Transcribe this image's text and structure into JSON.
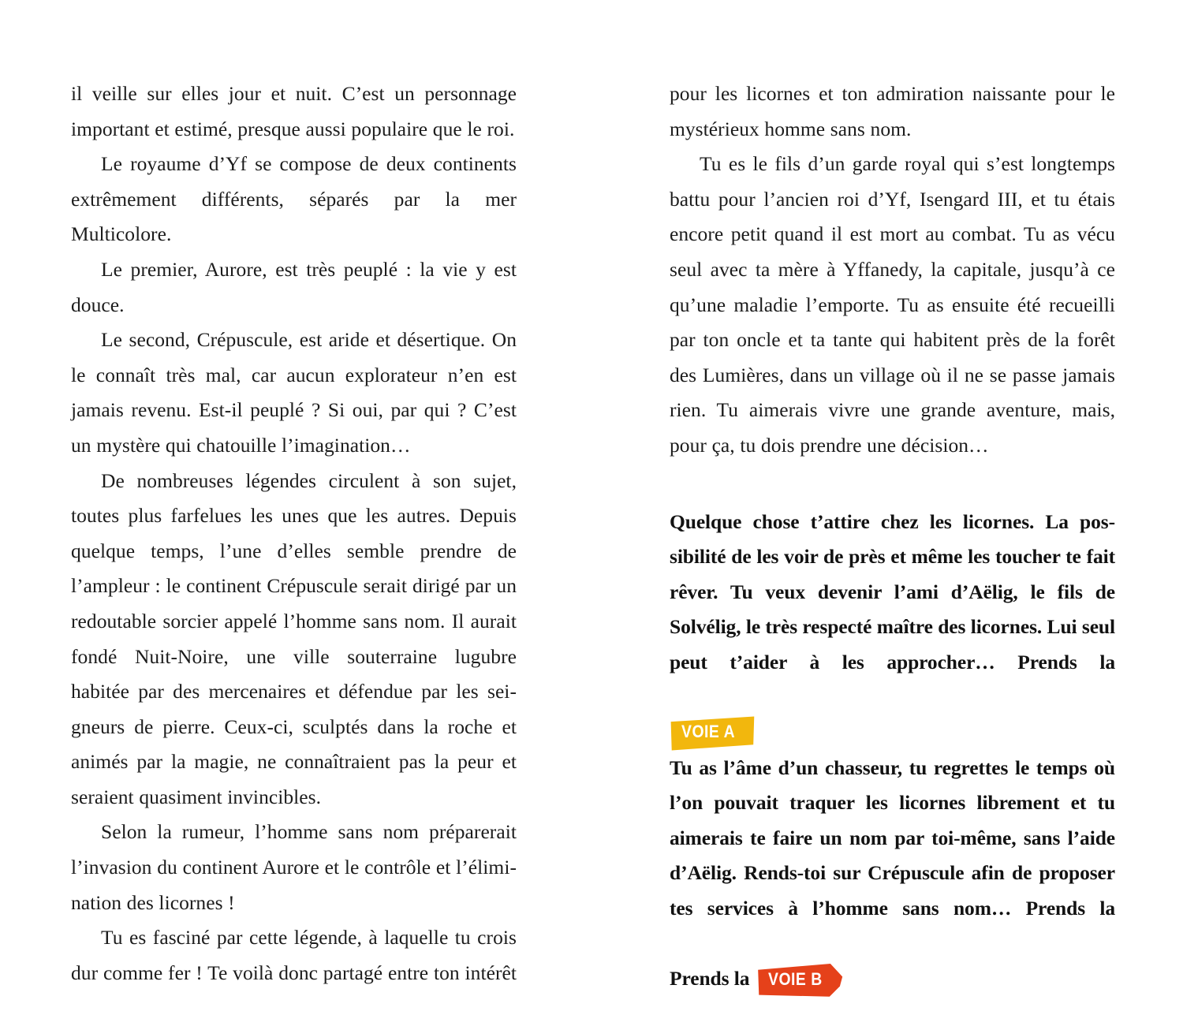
{
  "page": {
    "background_color": "#ffffff",
    "text_color": "#1c1c1c",
    "columns": 2
  },
  "colors": {
    "voie_a_badge": "#F2B70D",
    "voie_b_badge": "#E5411A",
    "badge_text": "#ffffff",
    "body_text": "#1c1c1c",
    "bold_text": "#121212"
  },
  "left_column": {
    "paragraphs": [
      {
        "id": "par-veille",
        "indent": false,
        "text": "il veille sur elles jour et nuit. C’est un personnage important et estimé, presque aussi populaire que le roi."
      },
      {
        "id": "par-royaume",
        "indent": true,
        "text": "Le royaume d’Yf se compose de deux continents extrêmement différents, séparés par la mer Multicolore."
      },
      {
        "id": "par-aurore",
        "indent": true,
        "text": "Le premier, Aurore, est très peuplé : la vie y est douce."
      },
      {
        "id": "par-crepuscule",
        "indent": true,
        "text": "Le second, Crépuscule, est aride et désertique. On le connaît très mal, car aucun explorateur n’en est jamais revenu. Est-il peuplé ? Si oui, par qui ? C’est un mystère qui chatouille l’imagination…"
      },
      {
        "id": "par-legendes",
        "indent": true,
        "text": "De nombreuses légendes circulent à son sujet, toutes plus farfelues les unes que les autres. Depuis quelque temps, l’une d’elles semble prendre de l’ampleur : le continent Crépuscule serait dirigé par un redoutable sorcier appelé l’homme sans nom. Il aurait fondé Nuit-Noire, une ville souterraine lugubre habitée par des mercenaires et défendue par les sei-gneurs de pierre. Ceux-ci, sculptés dans la roche et animés par la magie, ne connaîtraient pas la peur et seraient quasiment invincibles."
      },
      {
        "id": "par-rumeur",
        "indent": true,
        "text": "Selon la rumeur, l’homme sans nom préparerait l’invasion du continent Aurore et le contrôle et l’élimi-nation des licornes !"
      },
      {
        "id": "par-fascine",
        "indent": true,
        "text": "Tu es fasciné par cette légende, à laquelle tu crois dur comme fer ! Te voilà donc partagé entre ton intérêt"
      }
    ]
  },
  "right_column": {
    "paragraphs": [
      {
        "id": "par-admiration",
        "indent": false,
        "text": "pour les licornes et ton admiration naissante pour le mystérieux homme sans nom."
      },
      {
        "id": "par-fils",
        "indent": true,
        "text": "Tu es le fils d’un garde royal qui s’est longtemps battu pour l’ancien roi d’Yf, Isengard III, et tu étais encore petit quand il est mort au combat. Tu as vécu seul avec ta mère à Yffanedy, la capitale, jusqu’à ce qu’une maladie l’emporte. Tu as ensuite été recueilli par ton oncle et ta tante qui habitent près de la forêt des Lumières, dans un village où il ne se passe jamais rien. Tu aimerais vivre une grande aventure, mais, pour ça, tu dois prendre une décision…"
      }
    ],
    "choices": [
      {
        "id": "choice-a",
        "text_before_badge": "Quelque chose t’attire chez les licornes. La pos-sibilité de les voir de près et même les toucher te fait rêver. Tu veux devenir l’ami d’Aëlig, le fils de Solvélig, le très respecté maître des licornes. Lui seul peut t’aider à les approcher… Prends la",
        "badge_label": "VOIE A",
        "badge_color": "#F2B70D",
        "badge_on_own_line": true
      },
      {
        "id": "choice-b",
        "text_before_badge": "Tu as l’âme d’un chasseur, tu regrettes le temps où l’on pouvait traquer les licornes librement et tu aimerais te faire un nom par toi-même, sans l’aide d’Aëlig. Rends-toi sur Crépuscule afin de proposer tes services à l’homme sans nom… Prends la",
        "badge_label": "VOIE B",
        "badge_color": "#E5411A",
        "badge_on_own_line": false,
        "trailing_text": ""
      }
    ]
  }
}
